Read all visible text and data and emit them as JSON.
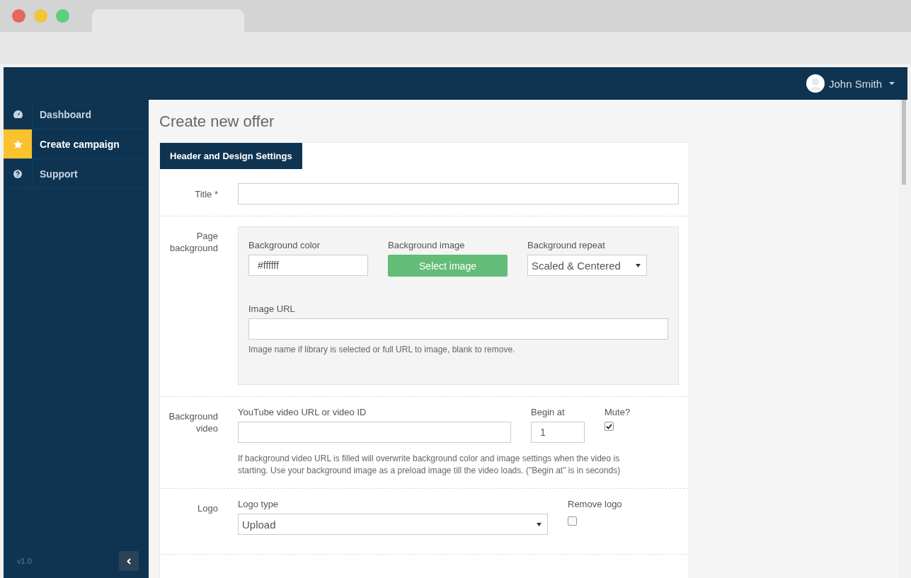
{
  "topbar": {
    "user_name": "John Smith"
  },
  "sidebar": {
    "items": [
      {
        "label": "Dashboard",
        "selected": false
      },
      {
        "label": "Create campaign",
        "selected": true
      },
      {
        "label": "Support",
        "selected": false
      }
    ],
    "version": "v1.0"
  },
  "page": {
    "title": "Create new offer",
    "section_tab": "Header and Design Settings",
    "title_field": {
      "label": "Title *"
    },
    "page_background": {
      "label": "Page background",
      "color_label": "Background color",
      "color_value": "#ffffff",
      "image_label": "Background image",
      "image_button": "Select image",
      "repeat_label": "Background repeat",
      "repeat_value": "Scaled & Centered",
      "url_label": "Image URL",
      "url_help": "Image name if library is selected or full URL to image, blank to remove."
    },
    "background_video": {
      "label": "Background video",
      "url_label": "YouTube video URL or video ID",
      "begin_label": "Begin at",
      "begin_value": "1",
      "mute_label": "Mute?",
      "mute_checked": true,
      "help": "If background video URL is filled will overwrite background color and image settings when the video is starting. Use your background image as a preload image till the video loads. (\"Begin at\" is in seconds)"
    },
    "logo": {
      "label": "Logo",
      "type_label": "Logo type",
      "type_value": "Upload",
      "remove_label": "Remove logo",
      "remove_checked": false
    }
  }
}
